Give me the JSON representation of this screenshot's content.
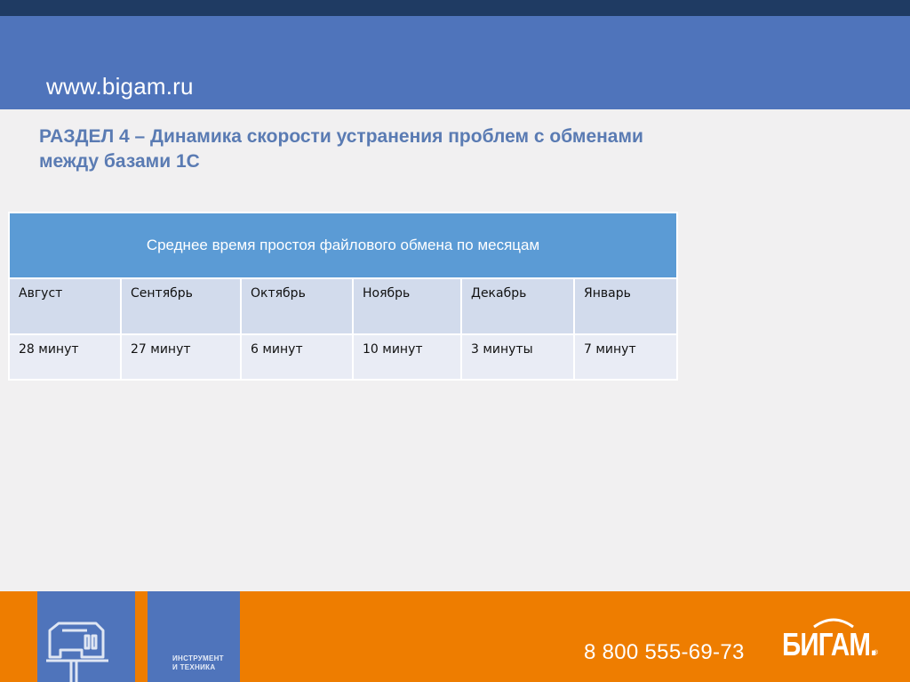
{
  "header": {
    "site_url": "www.bigam.ru"
  },
  "section": {
    "title": "РАЗДЕЛ 4 – Динамика скорости устранения проблем с обменами между базами 1С"
  },
  "table": {
    "caption": "Среднее время простоя файлового обмена по месяцам",
    "months": [
      "Август",
      "Сентябрь",
      "Октябрь",
      "Ноябрь",
      "Декабрь",
      "Январь"
    ],
    "values": [
      "28 минут",
      "27 минут",
      "6 минут",
      "10 минут",
      "3 минуты",
      "7 минут"
    ]
  },
  "footer": {
    "tagline_line1": "ИНСТРУМЕНТ",
    "tagline_line2": "И ТЕХНИКА",
    "phone": "8 800 555-69-73",
    "logo_text": "БИГАМ.",
    "logo_reg": "®"
  },
  "colors": {
    "header_blue": "#4f74bb",
    "top_bar_navy": "#1f3b63",
    "title_blue": "#5a7bb3",
    "table_header": "#5b9bd5",
    "footer_orange": "#ee7d00"
  }
}
